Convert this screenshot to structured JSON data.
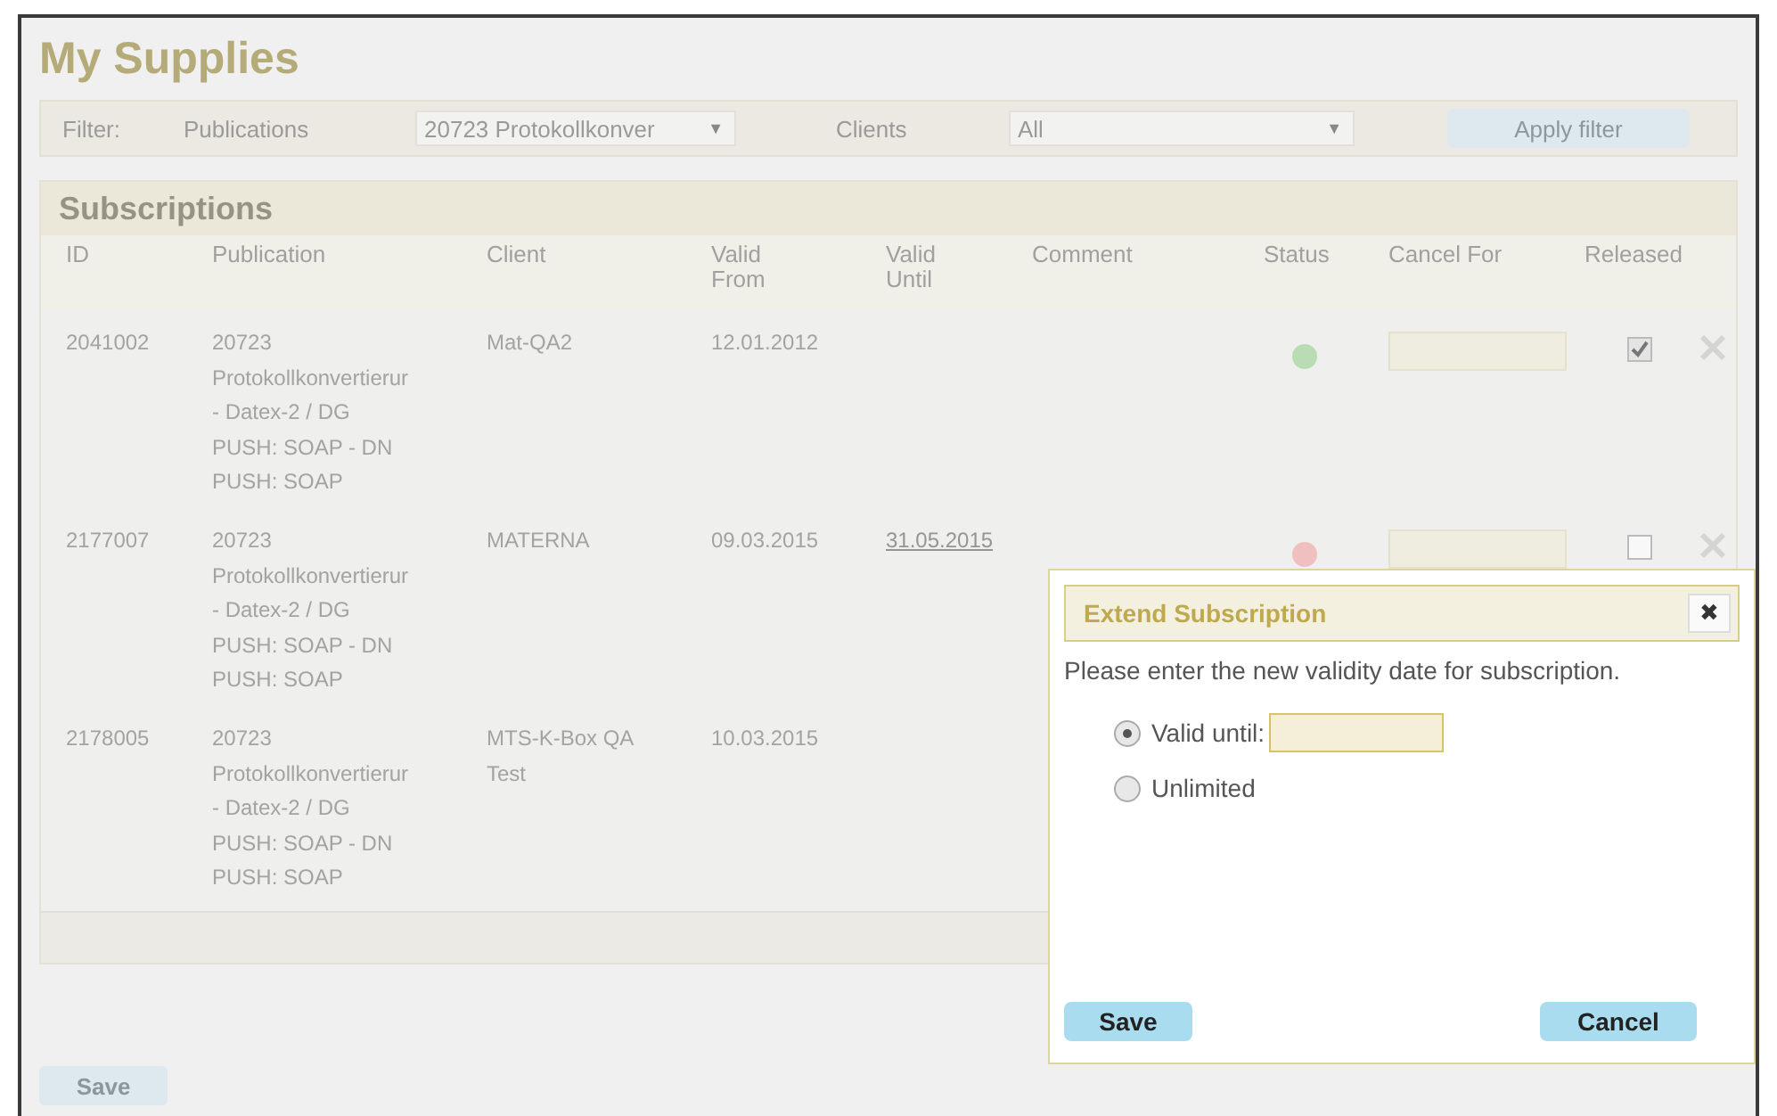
{
  "page": {
    "title": "My Supplies"
  },
  "filter": {
    "label": "Filter:",
    "publications_label": "Publications",
    "publications_value": "20723 Protokollkonver",
    "publications_caret": "▼",
    "clients_label": "Clients",
    "clients_value": "All",
    "clients_caret": "▼",
    "apply_button": "Apply filter"
  },
  "subscriptions": {
    "title": "Subscriptions",
    "columns": [
      "ID",
      "Publication",
      "Client",
      "Valid\nFrom",
      "Valid\nUntil",
      "Comment",
      "Status",
      "Cancel For",
      "Released"
    ],
    "rows": [
      {
        "id": "2041002",
        "publication": "20723\nProtokollkonvertierur\n- Datex-2 / DG\nPUSH: SOAP - DN\nPUSH: SOAP",
        "client": "Mat-QA2",
        "valid_from": "12.01.2012",
        "color": "#b9dcb4",
        "released": true
      },
      {
        "id": "2177007",
        "publication": "20723\nProtokollkonvertierur\n- Datex-2 / DG\nPUSH: SOAP - DN\nPUSH: SOAP",
        "client": "MATERNA",
        "valid_from": "09.03.2015",
        "valid_until": "31.05.2015",
        "color": "#f0c0c0",
        "released": false
      },
      {
        "id": "2178005",
        "publication": "20723\nProtokollkonvertierur\n- Datex-2 / DG\nPUSH: SOAP - DN\nPUSH: SOAP",
        "client": "MTS-K-Box QA\nTest",
        "valid_from": "10.03.2015"
      }
    ]
  },
  "save_button": "Save",
  "dialog": {
    "title": "Extend Subscription",
    "close": "✖",
    "message": "Please enter the new validity date for subscription.",
    "options": [
      {
        "label": "Valid until:",
        "selected": true,
        "kind": "date"
      },
      {
        "label": "Unlimited",
        "selected": false,
        "kind": "plain"
      }
    ],
    "save_button": "Save",
    "cancel_button": "Cancel"
  }
}
